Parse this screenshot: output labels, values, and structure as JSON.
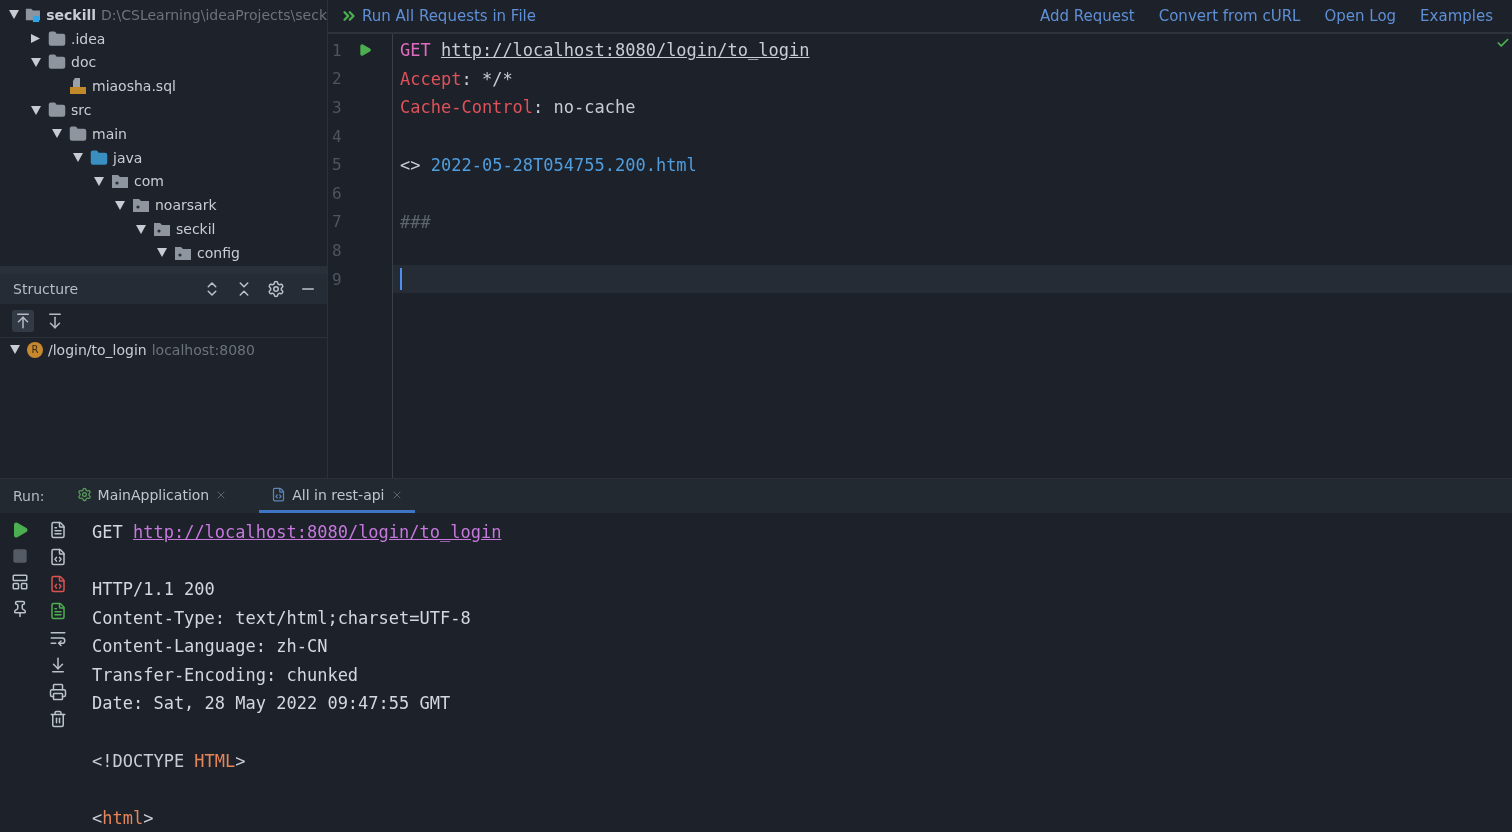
{
  "project_tree": [
    {
      "name": "seckill",
      "path": "D:\\CSLearning\\ideaProjects\\seck",
      "kind": "module",
      "expanded": true,
      "children": [
        {
          "name": ".idea",
          "kind": "folder",
          "expanded": false
        },
        {
          "name": "doc",
          "kind": "folder",
          "expanded": true,
          "children": [
            {
              "name": "miaosha.sql",
              "kind": "sql"
            }
          ]
        },
        {
          "name": "src",
          "kind": "folder",
          "expanded": true,
          "children": [
            {
              "name": "main",
              "kind": "folder",
              "expanded": true,
              "children": [
                {
                  "name": "java",
                  "kind": "source",
                  "expanded": true,
                  "children": [
                    {
                      "name": "com",
                      "kind": "package",
                      "expanded": true,
                      "children": [
                        {
                          "name": "noarsark",
                          "kind": "package",
                          "expanded": true,
                          "children": [
                            {
                              "name": "seckil",
                              "kind": "package",
                              "expanded": true,
                              "children": [
                                {
                                  "name": "config",
                                  "kind": "package",
                                  "expanded": true
                                }
                              ]
                            }
                          ]
                        }
                      ]
                    }
                  ]
                }
              ]
            }
          ]
        }
      ]
    }
  ],
  "structure": {
    "title": "Structure",
    "items": [
      {
        "badge": "R",
        "name": "/login/to_login",
        "host": "localhost:8080",
        "expanded": true
      }
    ]
  },
  "editor_toolbar": {
    "run_all": "Run All Requests in File",
    "links": [
      "Add Request",
      "Convert from cURL",
      "Open Log",
      "Examples"
    ]
  },
  "editor_lines": [
    {
      "number": "1",
      "kind": "request",
      "method": "GET",
      "url": "http://localhost:8080/login/to_login"
    },
    {
      "number": "2",
      "kind": "header",
      "name": "Accept",
      "sep": ":",
      "value": "*/*"
    },
    {
      "number": "3",
      "kind": "header",
      "name": "Cache-Control",
      "sep": ":",
      "value": "no-cache"
    },
    {
      "number": "4",
      "kind": "blank"
    },
    {
      "number": "5",
      "kind": "response",
      "marker": "<>",
      "file": "2022-05-28T054755.200.html"
    },
    {
      "number": "6",
      "kind": "blank"
    },
    {
      "number": "7",
      "kind": "separator",
      "text": "###"
    },
    {
      "number": "8",
      "kind": "blank"
    },
    {
      "number": "9",
      "kind": "blank",
      "current": true
    }
  ],
  "run_panel": {
    "label": "Run:",
    "tabs": [
      {
        "label": "MainApplication",
        "kind": "spring",
        "selected": false
      },
      {
        "label": "All in rest-api",
        "kind": "api",
        "selected": true
      }
    ],
    "output": [
      {
        "kind": "request",
        "method": "GET",
        "url": "http://localhost:8080/login/to_login"
      },
      {
        "kind": "blank"
      },
      {
        "kind": "text",
        "text": "HTTP/1.1 200"
      },
      {
        "kind": "text",
        "text": "Content-Type: text/html;charset=UTF-8"
      },
      {
        "kind": "text",
        "text": "Content-Language: zh-CN"
      },
      {
        "kind": "text",
        "text": "Transfer-Encoding: chunked"
      },
      {
        "kind": "text",
        "text": "Date: Sat, 28 May 2022 09:47:55 GMT"
      },
      {
        "kind": "blank"
      },
      {
        "kind": "markup",
        "open": "<!DOCTYPE ",
        "tag": "HTML",
        "close": ">"
      },
      {
        "kind": "blank"
      },
      {
        "kind": "markup",
        "open": "<",
        "tag": "html",
        "close": ">"
      }
    ]
  }
}
